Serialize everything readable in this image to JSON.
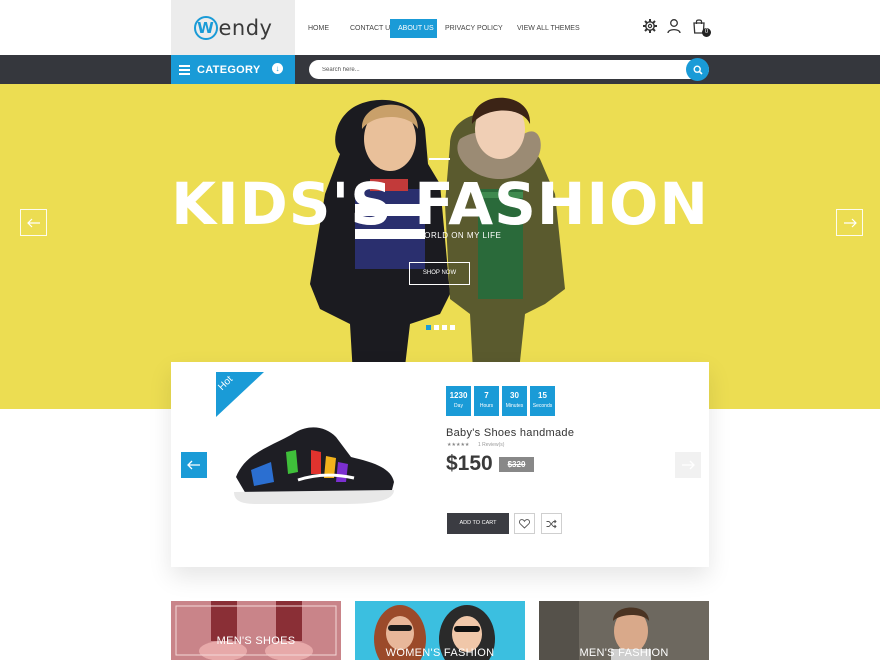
{
  "brand": {
    "logo_letter": "W",
    "logo_text": "endy"
  },
  "nav": {
    "items": [
      {
        "label": "HOME"
      },
      {
        "label": "CONTACT US"
      },
      {
        "label": "ABOUT US"
      },
      {
        "label": "PRIVACY POLICY"
      },
      {
        "label": "VIEW ALL THEMES"
      }
    ],
    "active": "ABOUT US"
  },
  "header_icons": [
    "gear-icon",
    "user-icon",
    "shopping-bag-icon"
  ],
  "cart": {
    "count": "0"
  },
  "category": {
    "label": "CATEGORY",
    "toggle_glyph": "↓"
  },
  "search": {
    "placeholder": "Search here..."
  },
  "hero": {
    "title": "KIDS'S FASHION",
    "subtitle": "BEAUTY WORLD ON MY LIFE",
    "cta": "SHOP NOW",
    "slide_count": 4,
    "active_slide": 1
  },
  "deal": {
    "badge": "Hot",
    "countdown": [
      {
        "value": "1230",
        "label": "Day"
      },
      {
        "value": "7",
        "label": "Hours"
      },
      {
        "value": "30",
        "label": "Minutes"
      },
      {
        "value": "15",
        "label": "Seconds"
      }
    ],
    "product_name": "Baby's Shoes handmade",
    "stars": "★★★★★",
    "reviews": "1 Review(s)",
    "price": "$150",
    "old_price": "$320",
    "add_to_cart": "ADD TO CART"
  },
  "categories": [
    {
      "label": "MEN'S SHOES"
    },
    {
      "label": "WOMEN'S FASHION"
    },
    {
      "label": "MEN'S FASHION"
    }
  ],
  "colors": {
    "accent": "#1a9bd7",
    "hero_bg": "#ecdd52",
    "dark_bar": "#35373d"
  }
}
